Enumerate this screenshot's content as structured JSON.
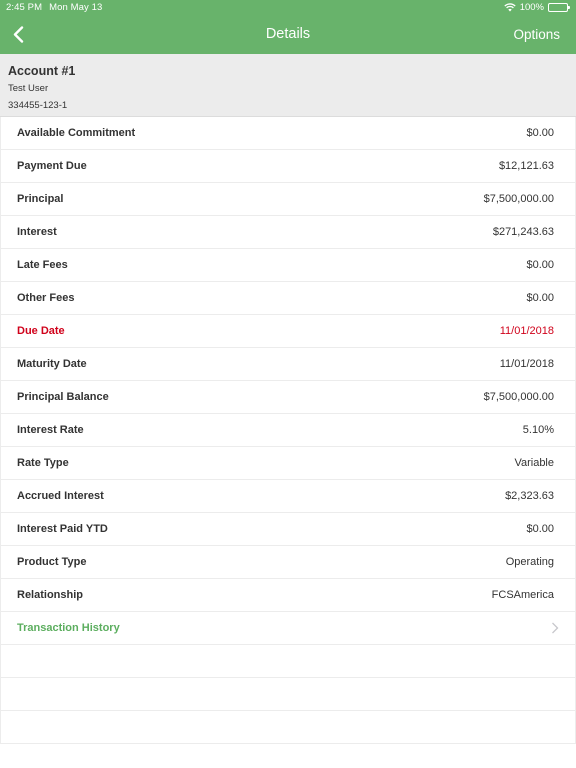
{
  "status": {
    "time": "2:45 PM",
    "date": "Mon May 13",
    "battery": "100%"
  },
  "nav": {
    "title": "Details",
    "options_label": "Options",
    "back_icon": "chevron-left-icon"
  },
  "account": {
    "name": "Account #1",
    "user": "Test User",
    "number": "334455-123-1"
  },
  "details": [
    {
      "label": "Available Commitment",
      "value": "$0.00"
    },
    {
      "label": "Payment Due",
      "value": "$12,121.63"
    },
    {
      "label": "Principal",
      "value": "$7,500,000.00"
    },
    {
      "label": "Interest",
      "value": "$271,243.63"
    },
    {
      "label": "Late Fees",
      "value": "$0.00"
    },
    {
      "label": "Other Fees",
      "value": "$0.00"
    },
    {
      "label": "Due Date",
      "value": "11/01/2018"
    },
    {
      "label": "Maturity Date",
      "value": "11/01/2018"
    },
    {
      "label": "Principal Balance",
      "value": "$7,500,000.00"
    },
    {
      "label": "Interest Rate",
      "value": "5.10%"
    },
    {
      "label": "Rate Type",
      "value": "Variable"
    },
    {
      "label": "Accrued Interest",
      "value": "$2,323.63"
    },
    {
      "label": "Interest Paid YTD",
      "value": "$0.00"
    },
    {
      "label": "Product Type",
      "value": "Operating"
    },
    {
      "label": "Relationship",
      "value": "FCSAmerica"
    }
  ],
  "transaction_history": {
    "label": "Transaction History"
  },
  "colors": {
    "header_green": "#68b36b",
    "link_green": "#5cae5f",
    "alert_red": "#d0021b"
  }
}
